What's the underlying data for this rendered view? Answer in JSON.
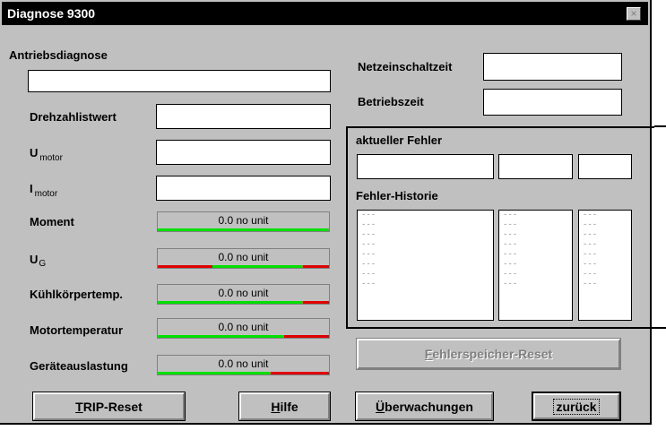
{
  "window": {
    "title": "Diagnose 9300",
    "close_symbol": "×"
  },
  "left": {
    "antriebsdiagnose_label": "Antriebsdiagnose",
    "drehzahl_label": "Drehzahlistwert",
    "umotor_label": "U",
    "umotor_sub": "motor",
    "imotor_label": "I",
    "imotor_sub": "motor",
    "moment_label": "Moment",
    "ug_label": "U",
    "ug_sub": "G",
    "kuehl_label": "Kühlkörpertemp.",
    "motortemp_label": "Motortemperatur",
    "geraete_label": "Geräteauslastung"
  },
  "meters": [
    {
      "text": "0.0 no unit",
      "bands": [
        [
          "g",
          1.0
        ]
      ]
    },
    {
      "text": "0.0 no unit",
      "bands": [
        [
          "r",
          0.32
        ],
        [
          "g",
          0.53
        ],
        [
          "r",
          0.15
        ]
      ]
    },
    {
      "text": "0.0 no unit",
      "bands": [
        [
          "g",
          0.85
        ],
        [
          "r",
          0.15
        ]
      ]
    },
    {
      "text": "0.0 no unit",
      "bands": [
        [
          "g",
          0.74
        ],
        [
          "r",
          0.26
        ]
      ]
    },
    {
      "text": "0.0 no unit",
      "bands": [
        [
          "g",
          0.66
        ],
        [
          "r",
          0.34
        ]
      ]
    }
  ],
  "right": {
    "netz_label": "Netzeinschaltzeit",
    "betrieb_label": "Betriebszeit",
    "aktueller_label": "aktueller Fehler",
    "historie_label": "Fehler-Historie"
  },
  "history": {
    "col1": [
      "---",
      "---",
      "---",
      "---",
      "---",
      "---",
      "---",
      "---"
    ],
    "col2": [
      "---",
      "---",
      "---",
      "---",
      "---",
      "---",
      "---",
      "---"
    ],
    "col3": [
      "---",
      "---",
      "---",
      "---",
      "---",
      "---",
      "---",
      "---"
    ]
  },
  "buttons": {
    "trip_reset_u": "T",
    "trip_reset_rest": "RIP-Reset",
    "hilfe_u": "H",
    "hilfe_rest": "ilfe",
    "ueberwachungen_u": "Ü",
    "ueberwachungen_rest": "berwachungen",
    "fehler_reset_u": "F",
    "fehler_reset_rest": "ehlerspeicher-Reset",
    "zurueck": "zurück"
  }
}
